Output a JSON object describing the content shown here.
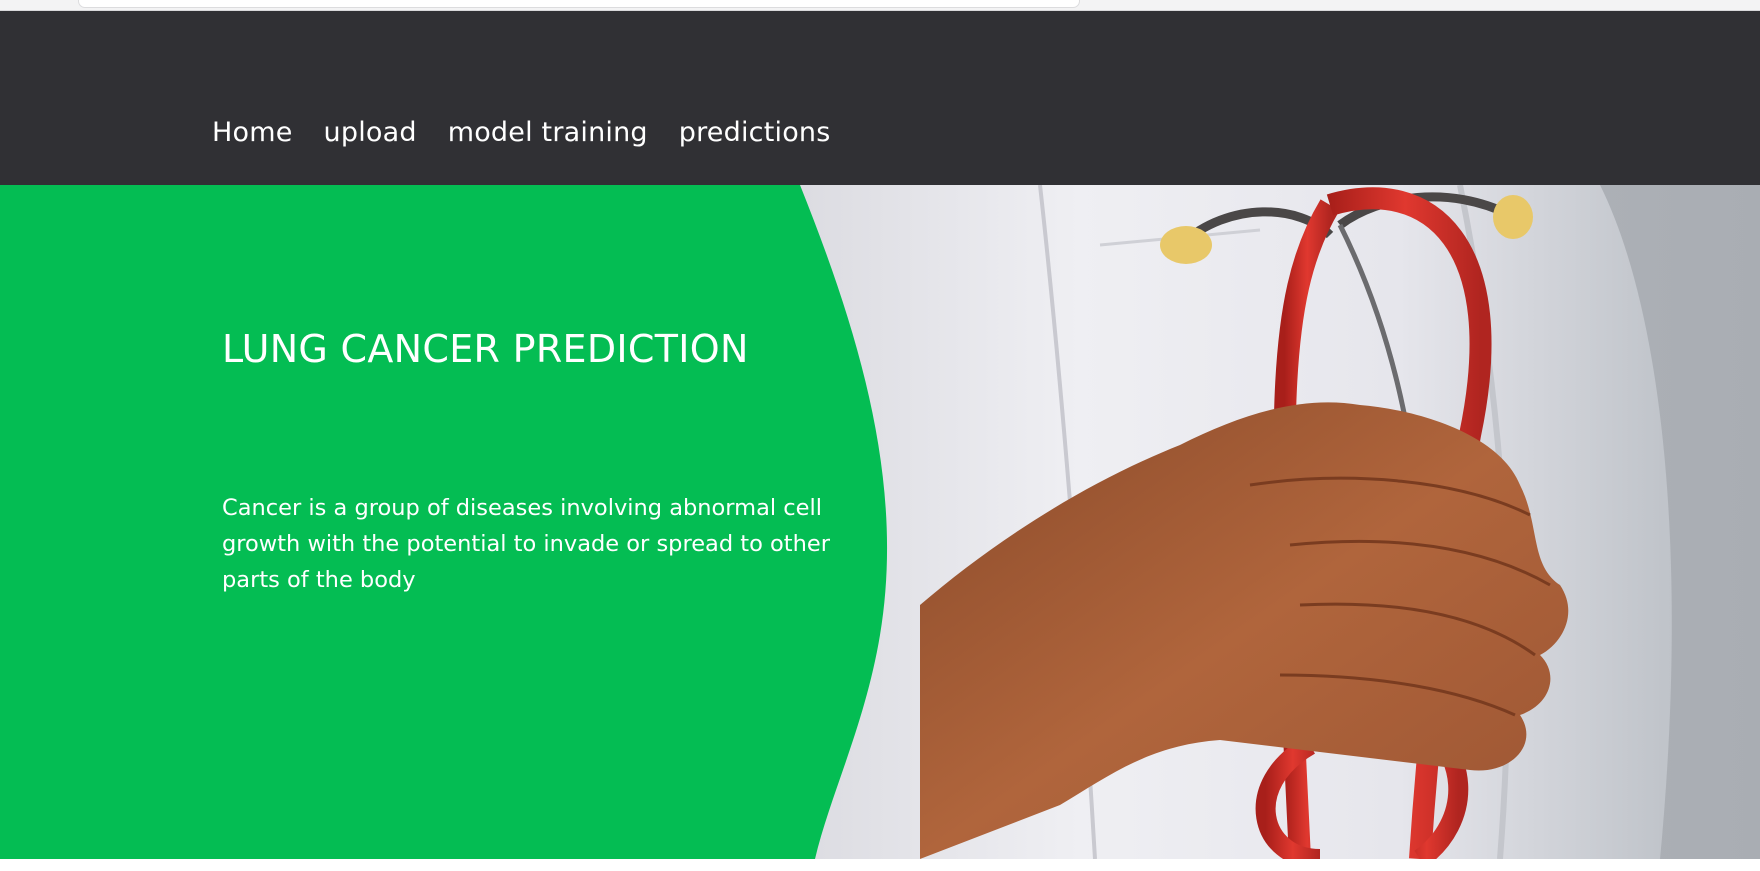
{
  "nav": {
    "items": [
      {
        "label": "Home"
      },
      {
        "label": "upload"
      },
      {
        "label": "model training"
      },
      {
        "label": "predictions"
      }
    ]
  },
  "hero": {
    "title": "LUNG CANCER PREDICTION",
    "description": "Cancer is a group of diseases involving abnormal cell growth with the potential to invade or spread to other parts of the body",
    "image_description": "doctor-holding-red-stethoscope"
  },
  "colors": {
    "navbar_background": "#303034",
    "hero_accent_green": "#04BD53",
    "stethoscope_red": "#D8322B",
    "coat_white": "#E9E9EE",
    "skin": "#B0653C"
  }
}
